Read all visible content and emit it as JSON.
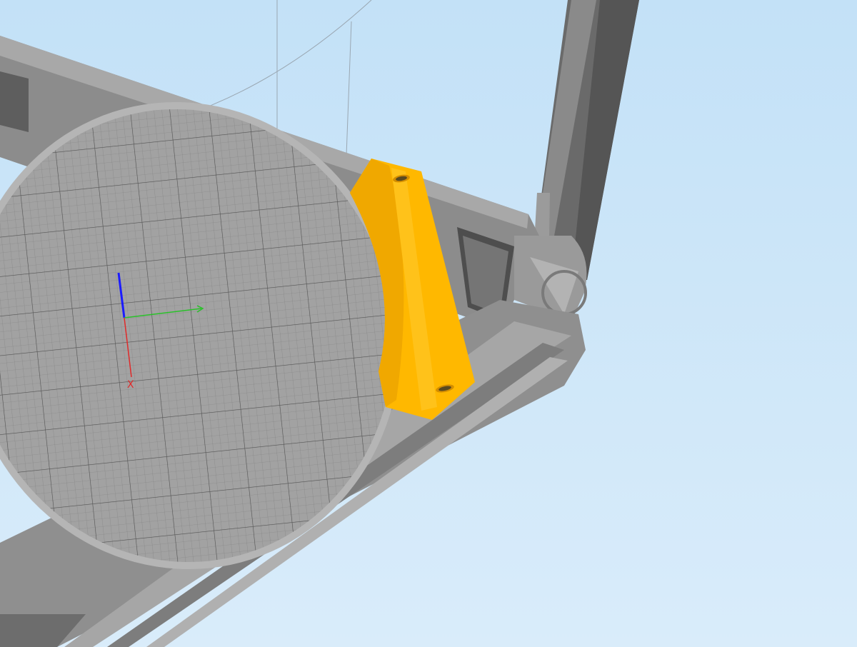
{
  "viewport": {
    "background_top": "#c3e1f7",
    "background_bottom": "#d9ecfa"
  },
  "axes": {
    "x_label": "X",
    "x_color": "#e02a2a",
    "y_color": "#2ac12a",
    "z_color": "#1c1cff"
  },
  "colors": {
    "frame": "#8d8d8d",
    "frame_light": "#a9a9a9",
    "frame_dark": "#5f5f5f",
    "bed": "#9e9e9e",
    "grid_major": "#5a5a5a",
    "grid_minor": "#7e7e7e",
    "selected_part": "#ffb800",
    "selected_part_shade": "#e69d00"
  },
  "objects": {
    "build_plate": "circular-build-plate",
    "frame": "delta-printer-frame",
    "part": "yellow-bracket-part"
  }
}
